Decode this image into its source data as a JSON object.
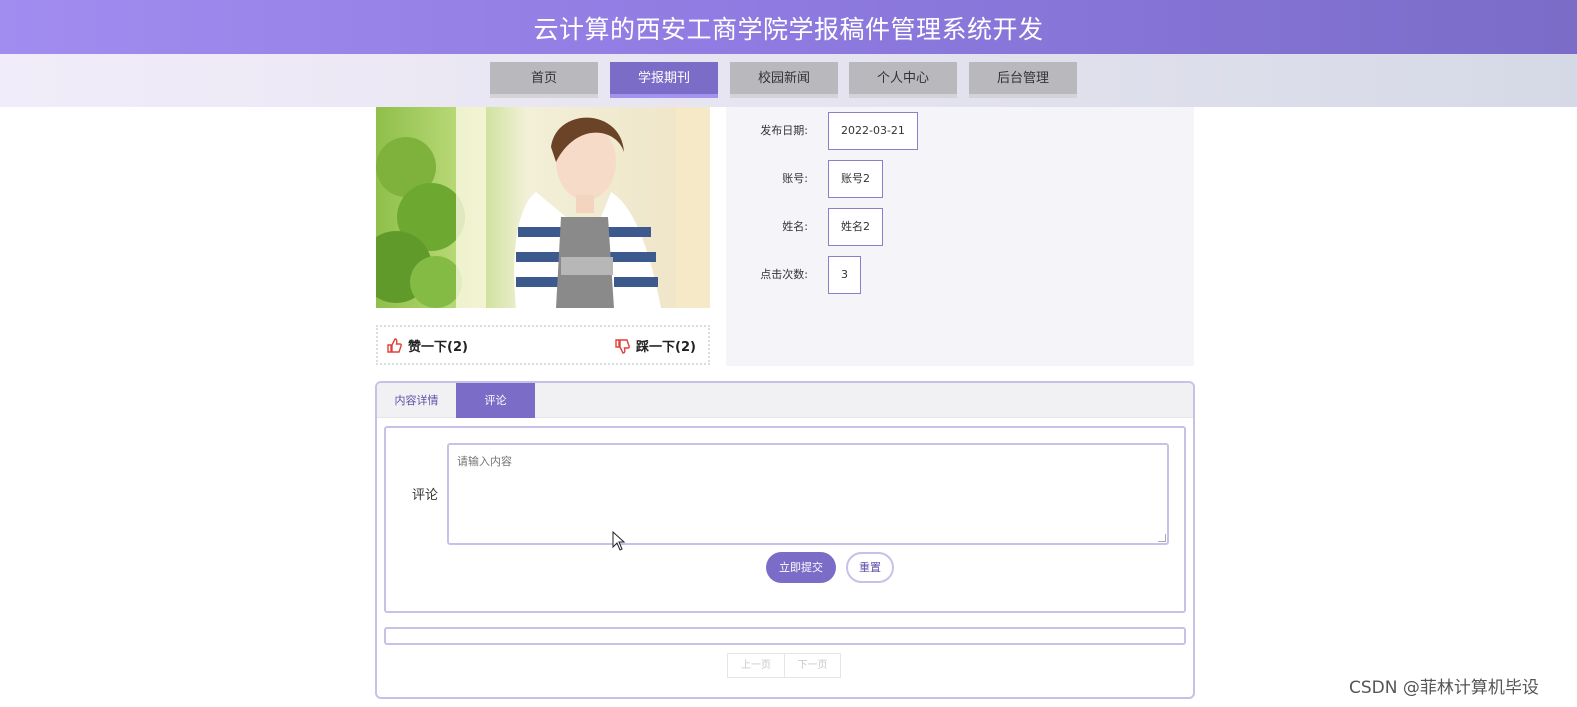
{
  "header": {
    "title": "云计算的西安工商学院学报稿件管理系统开发"
  },
  "nav": {
    "items": [
      {
        "label": "首页"
      },
      {
        "label": "学报期刊"
      },
      {
        "label": "校园新闻"
      },
      {
        "label": "个人中心"
      },
      {
        "label": "后台管理"
      }
    ],
    "active": "学报期刊"
  },
  "votes": {
    "like_label": "赞一下(2)",
    "dislike_label": "踩一下(2)",
    "like_count": 2,
    "dislike_count": 2
  },
  "info": {
    "rows": [
      {
        "label": "发布日期:",
        "value": "2022-03-21"
      },
      {
        "label": "账号:",
        "value": "账号2"
      },
      {
        "label": "姓名:",
        "value": "姓名2"
      },
      {
        "label": "点击次数:",
        "value": "3"
      }
    ]
  },
  "tabs": {
    "items": [
      {
        "label": "内容详情"
      },
      {
        "label": "评论"
      }
    ],
    "active": "评论"
  },
  "comment": {
    "label": "评论",
    "placeholder": "请输入内容",
    "submit_label": "立即提交",
    "reset_label": "重置"
  },
  "pagination": {
    "prev_label": "上一页",
    "next_label": "下一页"
  },
  "watermark": "CSDN @菲林计算机毕设",
  "colors": {
    "accent": "#7b6cc8",
    "header_start": "#a18cf0",
    "header_end": "#7b6cc8"
  }
}
